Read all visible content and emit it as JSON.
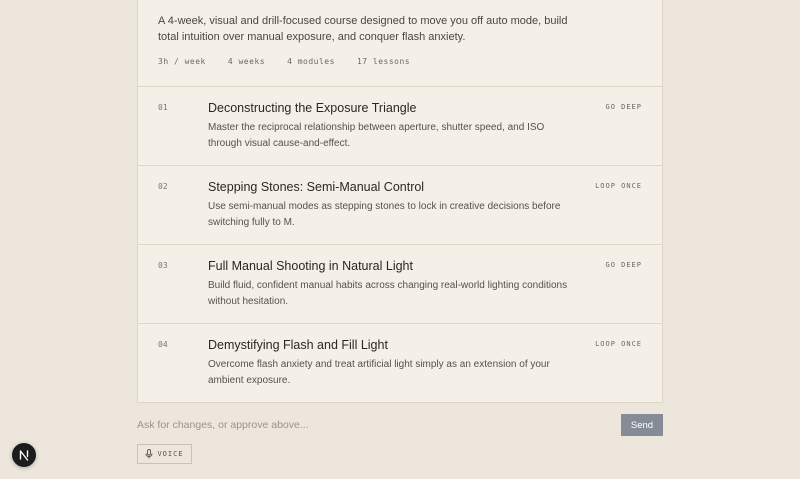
{
  "course": {
    "description": "A 4-week, visual and drill-focused course designed to move you off auto mode, build total intuition over manual exposure, and conquer flash anxiety.",
    "meta": [
      "3h / week",
      "4 weeks",
      "4 modules",
      "17 lessons"
    ]
  },
  "modules": [
    {
      "number": "01",
      "title": "Deconstructing the Exposure Triangle",
      "description": "Master the reciprocal relationship between aperture, shutter speed, and ISO through visual cause-and-effect.",
      "tag": "GO DEEP"
    },
    {
      "number": "02",
      "title": "Stepping Stones: Semi-Manual Control",
      "description": "Use semi-manual modes as stepping stones to lock in creative decisions before switching fully to M.",
      "tag": "LOOP ONCE"
    },
    {
      "number": "03",
      "title": "Full Manual Shooting in Natural Light",
      "description": "Build fluid, confident manual habits across changing real-world lighting conditions without hesitation.",
      "tag": "GO DEEP"
    },
    {
      "number": "04",
      "title": "Demystifying Flash and Fill Light",
      "description": "Overcome flash anxiety and treat artificial light simply as an extension of your ambient exposure.",
      "tag": "LOOP ONCE"
    }
  ],
  "prompt": {
    "placeholder": "Ask for changes, or approve above...",
    "value": "",
    "send_label": "Send",
    "voice_label": "VOICE",
    "voice_icon": "microphone-icon"
  },
  "badge": {
    "letter": "N",
    "icon": "next-logo-icon"
  },
  "colors": {
    "background": "#ece6dc",
    "card": "#f4f0e7",
    "send_button": "#858c97",
    "badge": "#1c1c1c"
  }
}
